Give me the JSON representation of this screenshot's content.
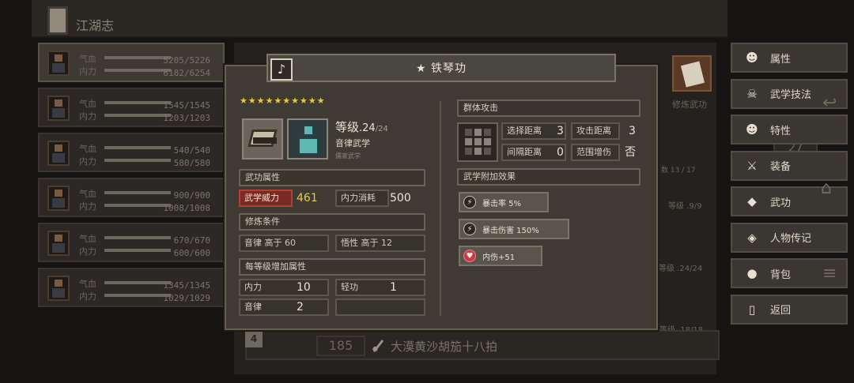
{
  "header": {
    "title": "江湖志"
  },
  "characters": [
    {
      "hp_label": "气血",
      "hp": "5205/5226",
      "mp_label": "内力",
      "mp": "6182/6254",
      "active": true
    },
    {
      "hp_label": "气血",
      "hp": "1545/1545",
      "mp_label": "内力",
      "mp": "1203/1203"
    },
    {
      "hp_label": "气血",
      "hp": "540/540",
      "mp_label": "内力",
      "mp": "580/580"
    },
    {
      "hp_label": "气血",
      "hp": "900/900",
      "mp_label": "内力",
      "mp": "1008/1008"
    },
    {
      "hp_label": "气血",
      "hp": "670/670",
      "mp_label": "内力",
      "mp": "600/600"
    },
    {
      "hp_label": "气血",
      "hp": "1345/1345",
      "mp_label": "内力",
      "mp": "1029/1029"
    }
  ],
  "background": {
    "corner_label": "修炼武功",
    "num1": "17",
    "num2": "27",
    "count": "数 13 / 17",
    "lvl1": "等级 .9/9",
    "lvl2": "等级 .24/24",
    "lvl3": "等级 .18/18",
    "bottom_badge": "4",
    "bottom_num": "185",
    "bottom_name": "大漠黄沙胡笳十八拍"
  },
  "menu": [
    {
      "label": "属性",
      "icon": "person-icon"
    },
    {
      "label": "武学技法",
      "icon": "skull-icon"
    },
    {
      "label": "特性",
      "icon": "trait-icon"
    },
    {
      "label": "装备",
      "icon": "sword-icon"
    },
    {
      "label": "武功",
      "icon": "book-icon"
    },
    {
      "label": "人物传记",
      "icon": "diamond-icon"
    },
    {
      "label": "背包",
      "icon": "bag-icon"
    },
    {
      "label": "返回",
      "icon": "door-icon"
    }
  ],
  "dialog": {
    "title": "★ 铁琴功",
    "stars": "★★★★★★★★★★",
    "level_label": "等级",
    "level_cur": ".24",
    "level_max": "/24",
    "type": "音律武学",
    "school": "儒家武学",
    "sec_props": "武功属性",
    "power_label": "武学威力",
    "power_value": "461",
    "cost_label": "内力消耗",
    "cost_value": "500",
    "sec_cond": "修炼条件",
    "cond1_label": "音律",
    "cond1_value": "高于 60",
    "cond2_label": "悟性",
    "cond2_value": "高于 12",
    "sec_per_level": "每等级增加属性",
    "lv_attr1_label": "内力",
    "lv_attr1_value": "10",
    "lv_attr2_label": "轻功",
    "lv_attr2_value": "1",
    "lv_attr3_label": "音律",
    "lv_attr3_value": "2",
    "sec_attack": "群体攻击",
    "select_range_label": "选择距离",
    "select_range_value": "3",
    "attack_range_label": "攻击距离",
    "attack_range_value": "3",
    "interval_label": "间隔距离",
    "interval_value": "0",
    "area_dmg_label": "范围增伤",
    "area_dmg_value": "否",
    "sec_effects": "武学附加效果",
    "effects": [
      {
        "icon": "lightning-icon",
        "text": "暴击率 5%"
      },
      {
        "icon": "lightning-icon",
        "text": "暴击伤害 150%"
      },
      {
        "icon": "heart-icon",
        "text": "内伤+51"
      }
    ]
  }
}
